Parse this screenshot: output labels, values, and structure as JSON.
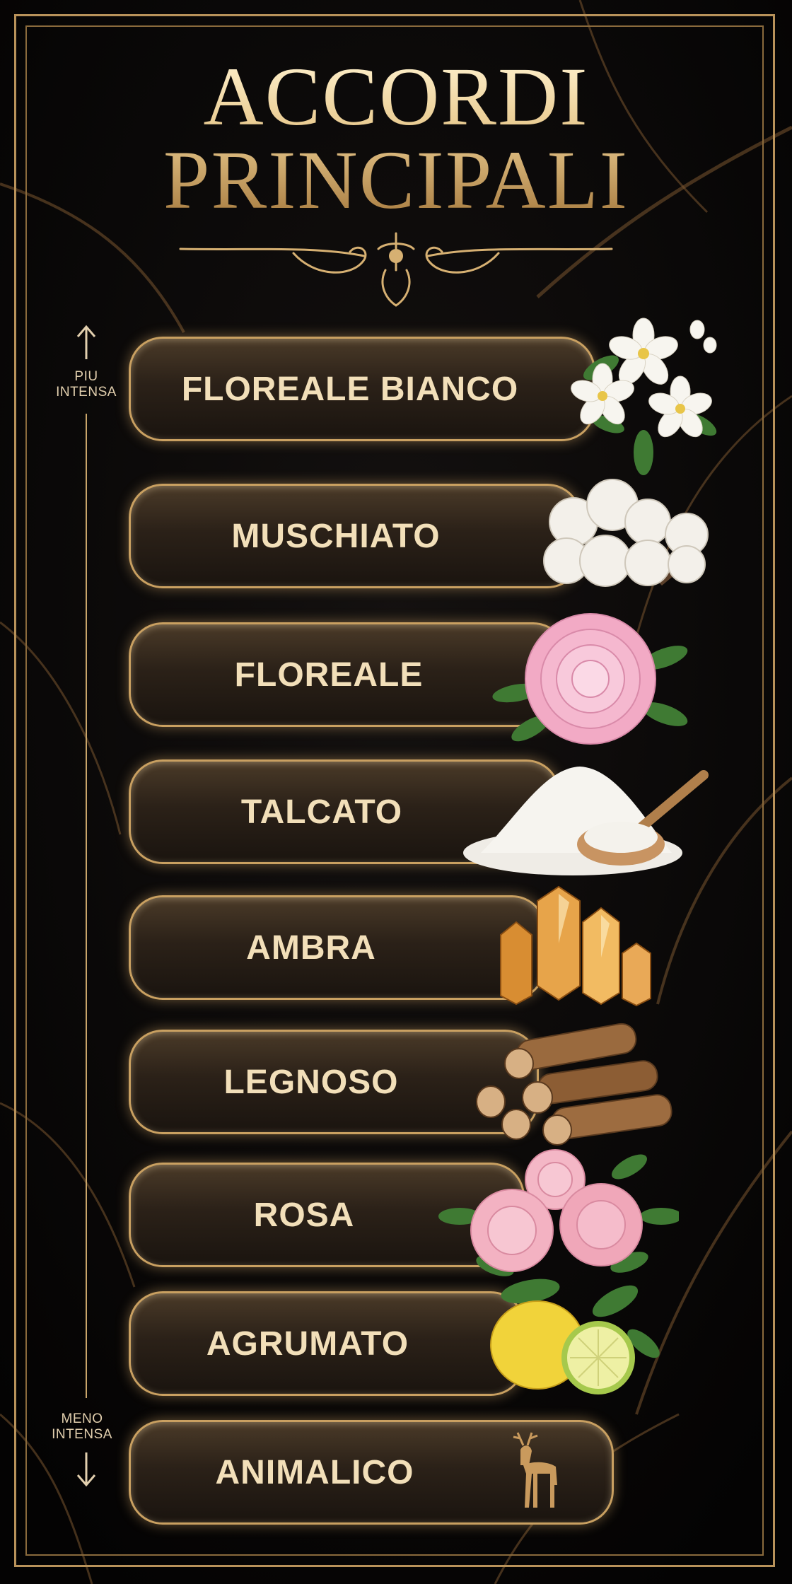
{
  "title": {
    "line1": "ACCORDI",
    "line2": "PRINCIPALI"
  },
  "axis": {
    "top_label": "PIU\nINTENSA",
    "bottom_label": "MENO\nINTENSA"
  },
  "accords": [
    {
      "label": "FLOREALE BIANCO",
      "image": "white-flowers-icon"
    },
    {
      "label": "MUSCHIATO",
      "image": "cotton-icon"
    },
    {
      "label": "FLOREALE",
      "image": "peony-icon"
    },
    {
      "label": "TALCATO",
      "image": "powder-icon"
    },
    {
      "label": "AMBRA",
      "image": "amber-crystal-icon"
    },
    {
      "label": "LEGNOSO",
      "image": "wood-logs-icon"
    },
    {
      "label": "ROSA",
      "image": "roses-icon"
    },
    {
      "label": "AGRUMATO",
      "image": "lemon-icon"
    },
    {
      "label": "ANIMALICO",
      "image": "deer-icon"
    }
  ],
  "colors": {
    "gold": "#c9a061",
    "background": "#060505",
    "text": "#f2dfb9"
  }
}
